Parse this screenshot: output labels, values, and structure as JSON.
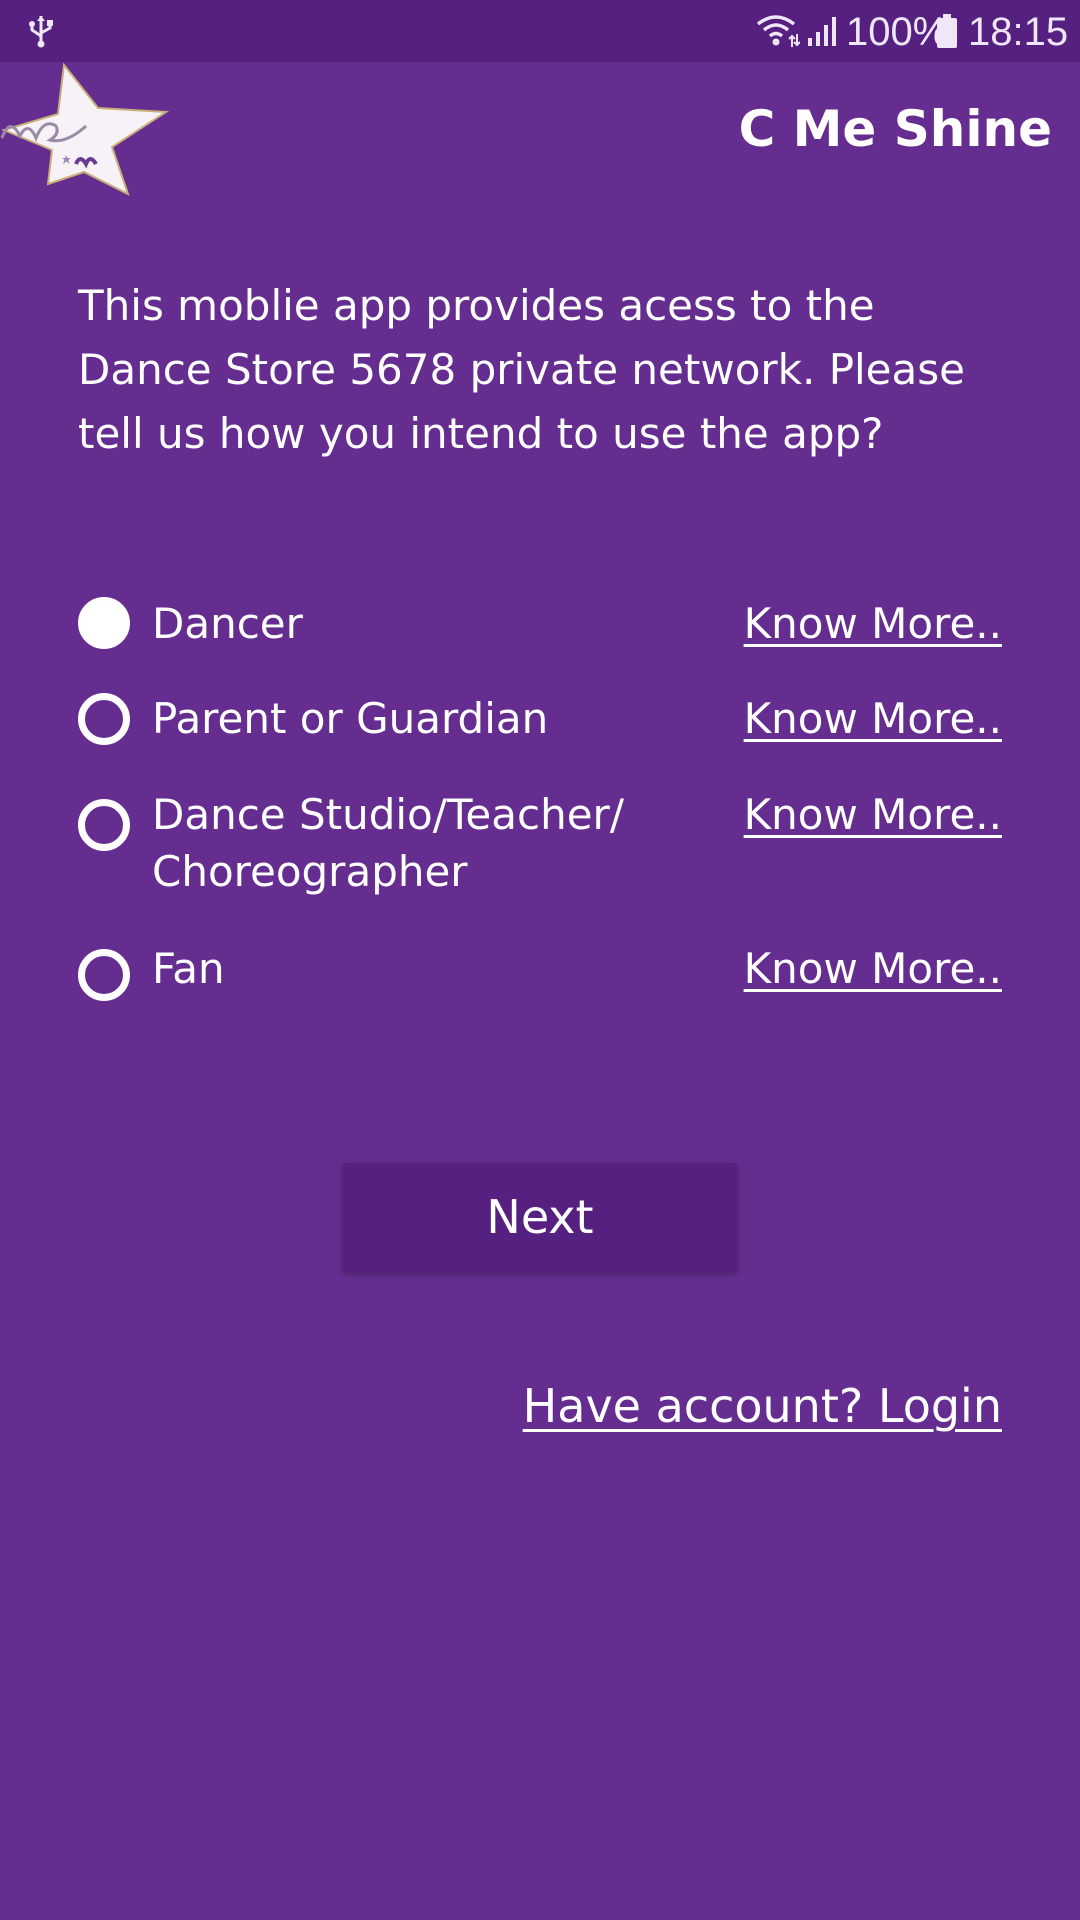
{
  "status_bar": {
    "battery_percent": "100%",
    "time": "18:15",
    "icons": [
      "usb-icon",
      "wifi-icon",
      "signal-icon",
      "battery-icon"
    ]
  },
  "header": {
    "app_title": "C Me Shine",
    "logo": "star-logo"
  },
  "intro_text": "This moblie app provides acess to the Dance Store 5678 private network. Please tell us how you intend to use the app?",
  "options": [
    {
      "label": "Dancer",
      "link": "Know More..",
      "selected": true
    },
    {
      "label": "Parent or Guardian",
      "link": "Know More..",
      "selected": false
    },
    {
      "label": "Dance Studio/Teacher/ Choreographer",
      "link": "Know More..",
      "selected": false
    },
    {
      "label": "Fan",
      "link": "Know More..",
      "selected": false
    }
  ],
  "next_button": "Next",
  "login_link": "Have account? Login",
  "colors": {
    "background": "#652d90",
    "status_bar": "#55207f",
    "button": "#55207f",
    "text": "#ffffff"
  }
}
